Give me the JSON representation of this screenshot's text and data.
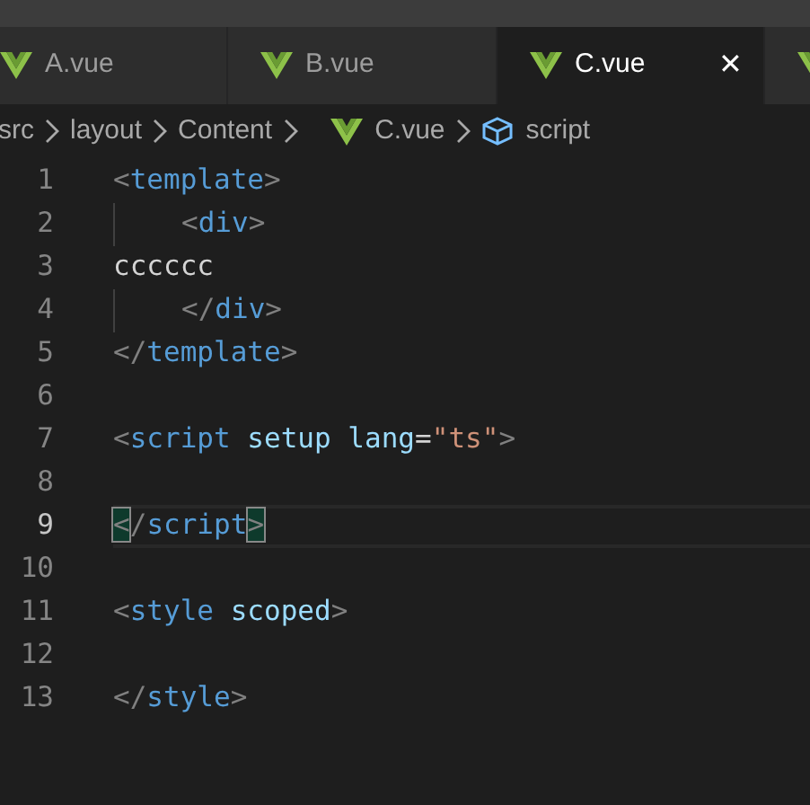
{
  "tabs": [
    {
      "label": "A.vue",
      "selected": false,
      "closable": false
    },
    {
      "label": "B.vue",
      "selected": false,
      "closable": false
    },
    {
      "label": "C.vue",
      "selected": true,
      "closable": true
    },
    {
      "selected": false
    }
  ],
  "close_glyph": "✕",
  "breadcrumb": [
    {
      "label": "src",
      "kind": "folder"
    },
    {
      "label": "layout",
      "kind": "folder"
    },
    {
      "label": "Content",
      "kind": "folder"
    },
    {
      "label": "C.vue",
      "kind": "vue"
    },
    {
      "label": "script",
      "kind": "symbol"
    }
  ],
  "editor": {
    "lines": [
      {
        "number": "1",
        "current": false,
        "indented": false,
        "tokens": [
          {
            "text": "<",
            "kind": "punct"
          },
          {
            "text": "template",
            "kind": "tag"
          },
          {
            "text": ">",
            "kind": "punct"
          }
        ]
      },
      {
        "number": "2",
        "current": false,
        "indented": true,
        "tokens": [
          {
            "text": "<",
            "kind": "punct"
          },
          {
            "text": "div",
            "kind": "tag"
          },
          {
            "text": ">",
            "kind": "punct"
          }
        ]
      },
      {
        "number": "3",
        "current": false,
        "indented": false,
        "tokens": [
          {
            "text": "cccccc",
            "kind": "text"
          }
        ]
      },
      {
        "number": "4",
        "current": false,
        "indented": true,
        "tokens": [
          {
            "text": "</",
            "kind": "punct"
          },
          {
            "text": "div",
            "kind": "tag"
          },
          {
            "text": ">",
            "kind": "punct"
          }
        ]
      },
      {
        "number": "5",
        "current": false,
        "indented": false,
        "tokens": [
          {
            "text": "</",
            "kind": "punct"
          },
          {
            "text": "template",
            "kind": "tag"
          },
          {
            "text": ">",
            "kind": "punct"
          }
        ]
      },
      {
        "number": "6",
        "current": false,
        "indented": false
      },
      {
        "number": "7",
        "current": false,
        "indented": false,
        "tokens": [
          {
            "text": "<",
            "kind": "punct"
          },
          {
            "text": "script",
            "kind": "tag"
          },
          {
            "text": " setup",
            "kind": "attr"
          },
          {
            "text": " lang",
            "kind": "attr"
          },
          {
            "text": "=",
            "kind": "text"
          },
          {
            "text": "\"ts\"",
            "kind": "string"
          },
          {
            "text": ">",
            "kind": "punct"
          }
        ]
      },
      {
        "number": "8",
        "current": false,
        "indented": false
      },
      {
        "number": "9",
        "current": true,
        "indented": false,
        "tokens": [
          {
            "text": "<",
            "kind": "punct",
            "matched": true
          },
          {
            "text": "/",
            "kind": "punct"
          },
          {
            "text": "script",
            "kind": "tag"
          },
          {
            "text": ">",
            "kind": "punct",
            "matched": true
          }
        ]
      },
      {
        "number": "10",
        "current": false,
        "indented": false
      },
      {
        "number": "11",
        "current": false,
        "indented": false,
        "tokens": [
          {
            "text": "<",
            "kind": "punct"
          },
          {
            "text": "style",
            "kind": "tag"
          },
          {
            "text": " scoped",
            "kind": "attr"
          },
          {
            "text": ">",
            "kind": "punct"
          }
        ]
      },
      {
        "number": "12",
        "current": false,
        "indented": false
      },
      {
        "number": "13",
        "current": false,
        "indented": false,
        "tokens": [
          {
            "text": "</",
            "kind": "punct"
          },
          {
            "text": "style",
            "kind": "tag"
          },
          {
            "text": ">",
            "kind": "punct"
          }
        ]
      }
    ]
  }
}
